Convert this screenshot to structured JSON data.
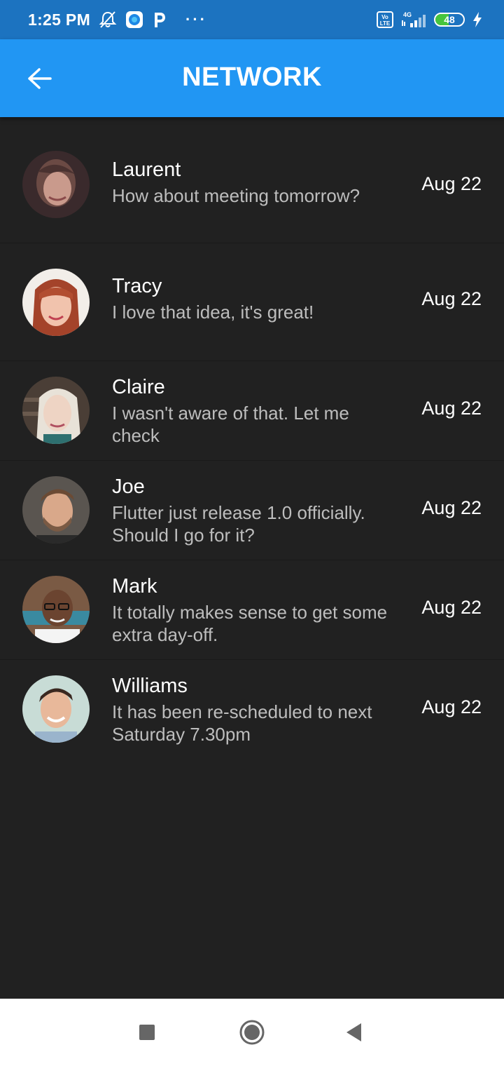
{
  "status_bar": {
    "time": "1:25 PM",
    "battery": "48",
    "battery_level": 0.48,
    "network": "4G",
    "volte": "Vo LTE",
    "icons": [
      "mute-icon",
      "browser-icon",
      "p-icon",
      "more-dots-icon",
      "volte-icon",
      "signal-icon",
      "battery-icon",
      "charging-icon"
    ]
  },
  "app_bar": {
    "title": "NETWORK",
    "back_icon": "arrow-left-icon"
  },
  "contacts": [
    {
      "name": "Laurent",
      "message": "How about meeting tomorrow?",
      "date": "Aug 22"
    },
    {
      "name": "Tracy",
      "message": "I love that idea, it's great!",
      "date": "Aug 22"
    },
    {
      "name": "Claire",
      "message": "I wasn't aware of that. Let me check",
      "date": "Aug 22"
    },
    {
      "name": "Joe",
      "message": "Flutter just release 1.0 officially. Should I go for it?",
      "date": "Aug 22"
    },
    {
      "name": "Mark",
      "message": "It totally makes sense to get some extra day-off.",
      "date": "Aug 22"
    },
    {
      "name": "Williams",
      "message": "It has been re-scheduled to next Saturday 7.30pm",
      "date": "Aug 22"
    }
  ],
  "nav_bar": {
    "icons": [
      "recents-square-icon",
      "home-circle-icon",
      "back-triangle-icon"
    ]
  },
  "colors": {
    "app_bar": "#2196f3",
    "status_bar": "#1c73c0",
    "background": "#212121",
    "battery": "#46c53d"
  }
}
